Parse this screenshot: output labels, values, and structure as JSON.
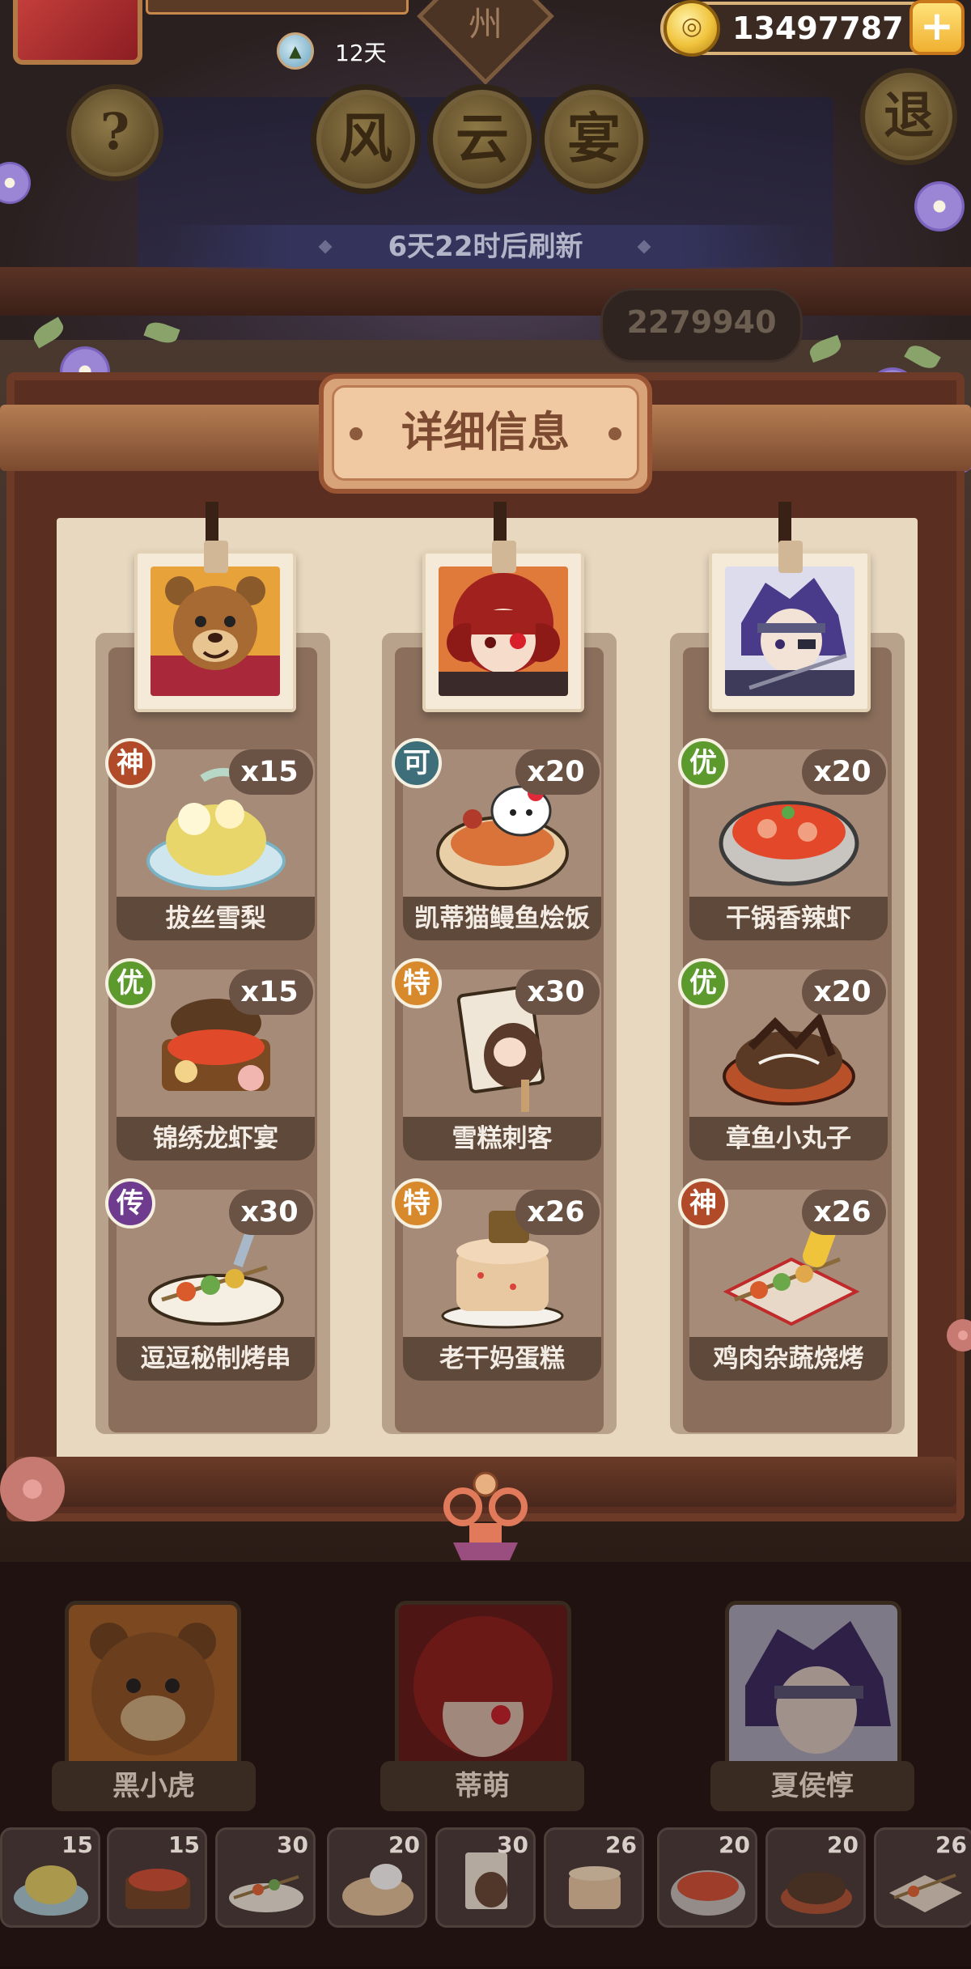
{
  "header": {
    "zhou_label": "州",
    "days_label": "12天",
    "coins": "13497787",
    "coin_plus": "+",
    "help_label": "?",
    "quit_label": "退",
    "title_chars": [
      "风",
      "云",
      "宴"
    ],
    "refresh_text": "6天22时后刷新",
    "score_text": "2279940"
  },
  "panel": {
    "title": "详细信息"
  },
  "columns": [
    {
      "character": "黑小虎",
      "dishes": [
        {
          "rarity": "神",
          "count": "x15",
          "name": "拔丝雪梨"
        },
        {
          "rarity": "优",
          "count": "x15",
          "name": "锦绣龙虾宴"
        },
        {
          "rarity": "传",
          "count": "x30",
          "name": "逗逗秘制烤串"
        }
      ]
    },
    {
      "character": "蒂萌",
      "dishes": [
        {
          "rarity": "可",
          "count": "x20",
          "name": "凯蒂猫鳗鱼烩饭"
        },
        {
          "rarity": "特",
          "count": "x30",
          "name": "雪糕刺客"
        },
        {
          "rarity": "特",
          "count": "x26",
          "name": "老干妈蛋糕"
        }
      ]
    },
    {
      "character": "夏侯惇",
      "dishes": [
        {
          "rarity": "优",
          "count": "x20",
          "name": "干锅香辣虾"
        },
        {
          "rarity": "优",
          "count": "x20",
          "name": "章鱼小丸子"
        },
        {
          "rarity": "神",
          "count": "x26",
          "name": "鸡肉杂蔬烧烤"
        }
      ]
    }
  ],
  "roster": [
    "黑小虎",
    "蒂萌",
    "夏侯惇"
  ],
  "thumbs": [
    "15",
    "15",
    "30",
    "20",
    "30",
    "26",
    "20",
    "20",
    "26"
  ],
  "colors": {
    "rarity_shen": "#b04a28",
    "rarity_ke": "#3e6e79",
    "rarity_you": "#5d9a2e",
    "rarity_te": "#d7892c",
    "rarity_chuan": "#6f3b8e"
  }
}
